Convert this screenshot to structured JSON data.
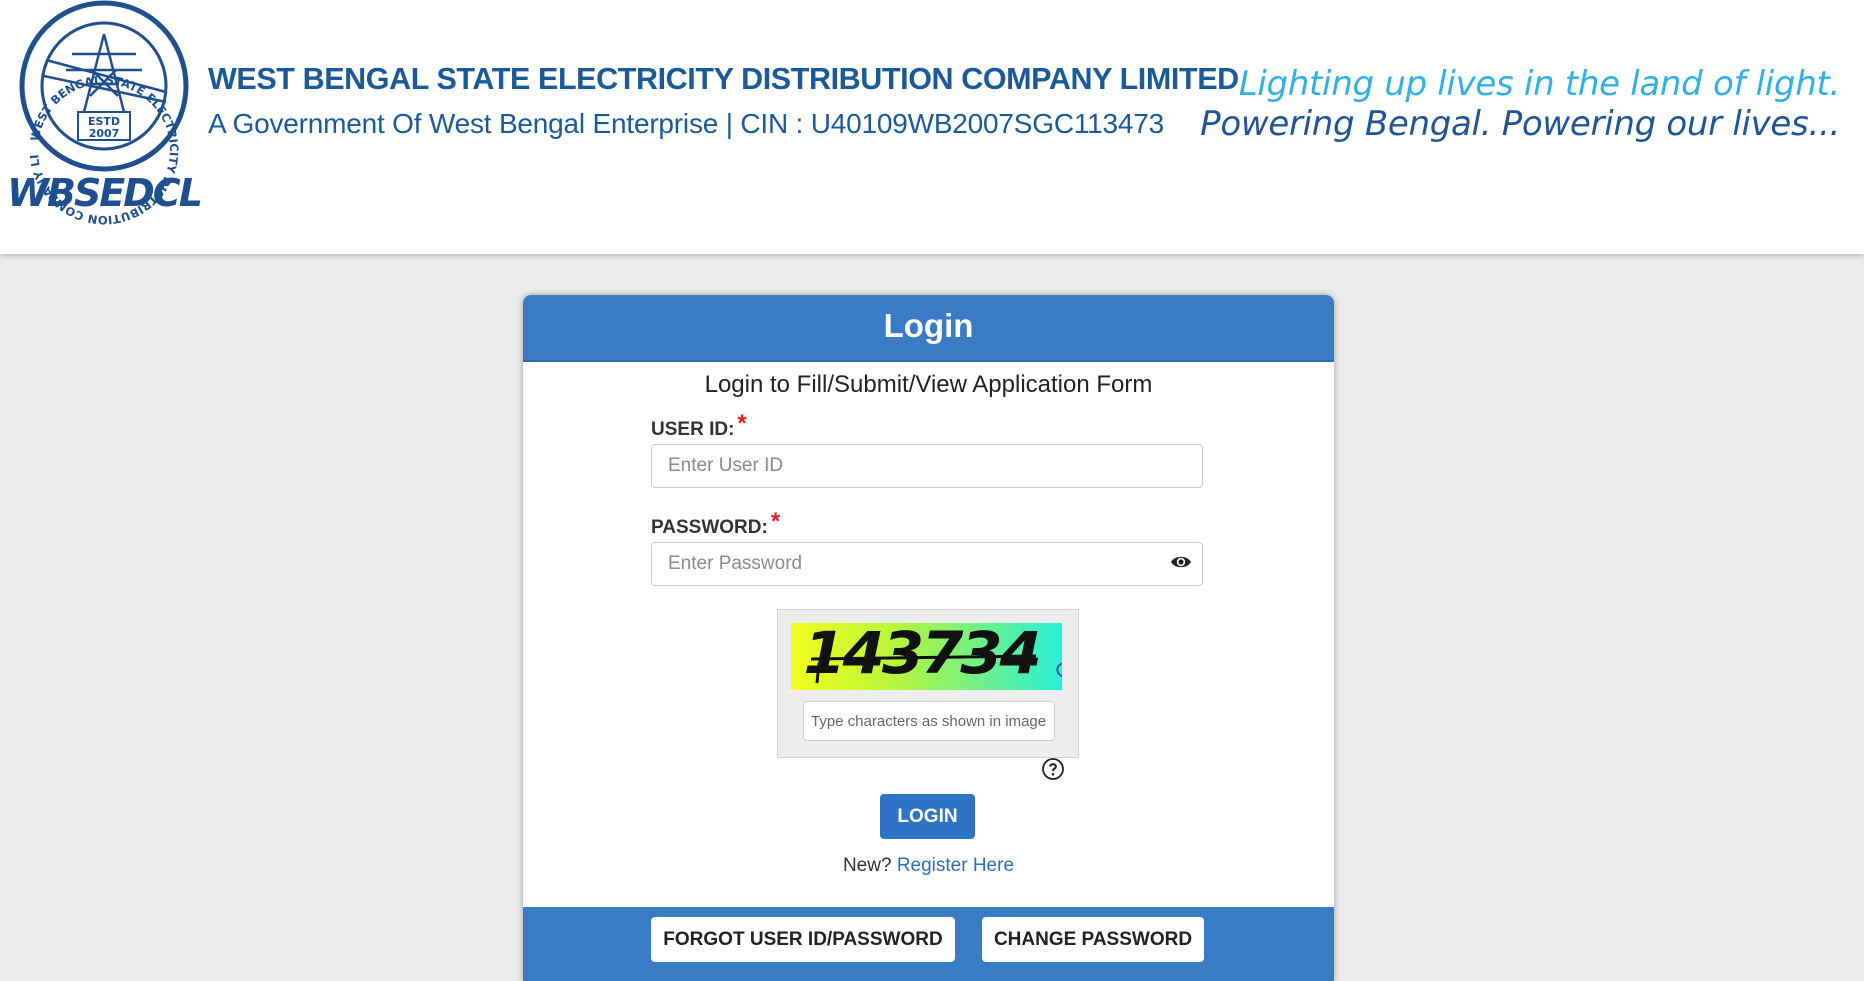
{
  "header": {
    "logo_text": "WBSEDCL",
    "logo_ring_text": "WEST BENGAL STATE ELECTRICITY DISTRIBUTION COMPANY LIMITED",
    "logo_estd": "ESTD",
    "logo_year": "2007",
    "org_name": "WEST BENGAL STATE ELECTRICITY DISTRIBUTION COMPANY LIMITED",
    "org_subtitle": "A Government Of West Bengal Enterprise | CIN : U40109WB2007SGC113473",
    "tagline_1": "Lighting up lives in the land of light.",
    "tagline_2": "Powering Bengal. Powering our lives..."
  },
  "login": {
    "title": "Login",
    "subtitle": "Login to Fill/Submit/View Application Form",
    "user_id_label": "USER ID:",
    "user_id_placeholder": "Enter User ID",
    "password_label": "PASSWORD:",
    "password_placeholder": "Enter Password",
    "required_mark": "*",
    "captcha_value": "143734",
    "captcha_placeholder": "Type characters as shown in image",
    "login_button": "LOGIN",
    "new_text": "New?",
    "register_link": "Register Here",
    "forgot_button": "FORGOT USER ID/PASSWORD",
    "change_password_button": "CHANGE PASSWORD"
  },
  "icons": {
    "password_toggle": "eye-icon",
    "captcha_refresh": "refresh-icon",
    "captcha_help": "question-circle-icon"
  },
  "colors": {
    "primary_blue": "#3a7bc6",
    "header_text": "#1b5a98",
    "tagline_light": "#2fb0e6",
    "required": "#e02020",
    "link": "#2f6fb8"
  }
}
